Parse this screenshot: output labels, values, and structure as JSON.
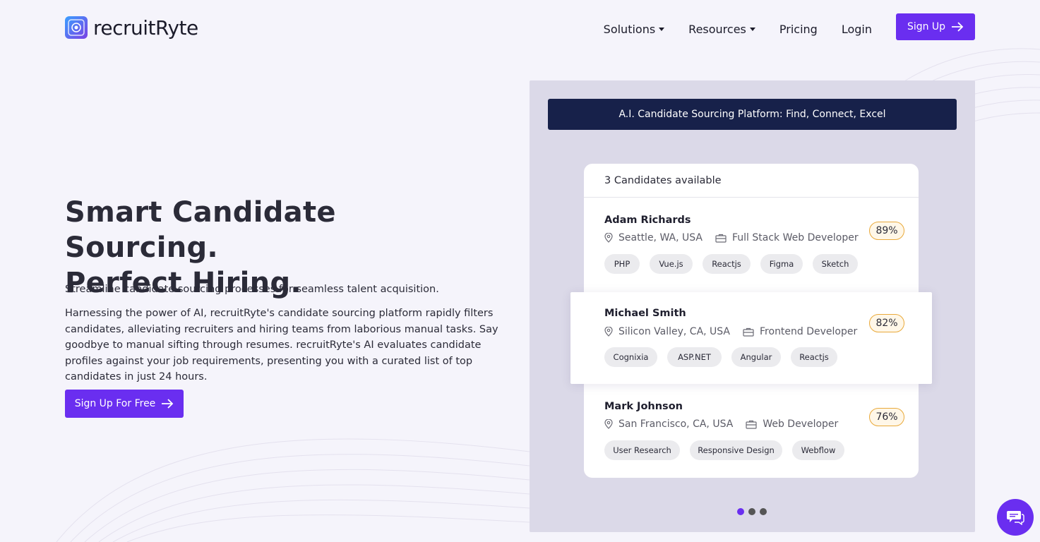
{
  "nav": {
    "logo_text": "recruitRyte",
    "items": [
      {
        "label": "Solutions",
        "dropdown": true
      },
      {
        "label": "Resources",
        "dropdown": true
      },
      {
        "label": "Pricing",
        "dropdown": false
      },
      {
        "label": "Login",
        "dropdown": false
      }
    ],
    "signup_label": "Sign Up"
  },
  "hero": {
    "title_line1": "Smart Candidate Sourcing.",
    "title_line2": "Perfect Hiring.",
    "subtitle": "Streamline candidate sourcing processes for seamless talent acquisition.",
    "body": "Harnessing the power of AI, recruitRyte's candidate sourcing platform rapidly filters candidates, alleviating recruiters and hiring teams from laborious manual tasks. Say goodbye to manual sifting through resumes. recruitRyte's AI evaluates candidate profiles against your job requirements, presenting you with a curated list of top candidates in just 24 hours.",
    "cta_label": "Sign Up For Free"
  },
  "panel": {
    "banner": "A.I. Candidate Sourcing Platform: Find, Connect, Excel",
    "header": "3 Candidates available",
    "candidates": [
      {
        "name": "Adam Richards",
        "location": "Seattle, WA, USA",
        "role": "Full Stack Web Developer",
        "score": "89%",
        "tags": [
          "PHP",
          "Vue.js",
          "Reactjs",
          "Figma",
          "Sketch"
        ]
      },
      {
        "name": "Michael Smith",
        "location": "Silicon Valley, CA, USA",
        "role": "Frontend Developer",
        "score": "82%",
        "tags": [
          "Cognixia",
          "ASP.NET",
          "Angular",
          "Reactjs"
        ]
      },
      {
        "name": "Mark Johnson",
        "location": "San Francisco, CA, USA",
        "role": "Web Developer",
        "score": "76%",
        "tags": [
          "User Research",
          "Responsive Design",
          "Webflow"
        ]
      }
    ],
    "carousel_active": 1,
    "carousel_count": 3
  },
  "colors": {
    "accent": "#6a2ef0",
    "banner": "#17214a",
    "score_border": "#e9a93a"
  },
  "icons": [
    "location-pin-icon",
    "briefcase-icon",
    "arrow-right-icon",
    "chat-icon",
    "caret-down-icon"
  ]
}
